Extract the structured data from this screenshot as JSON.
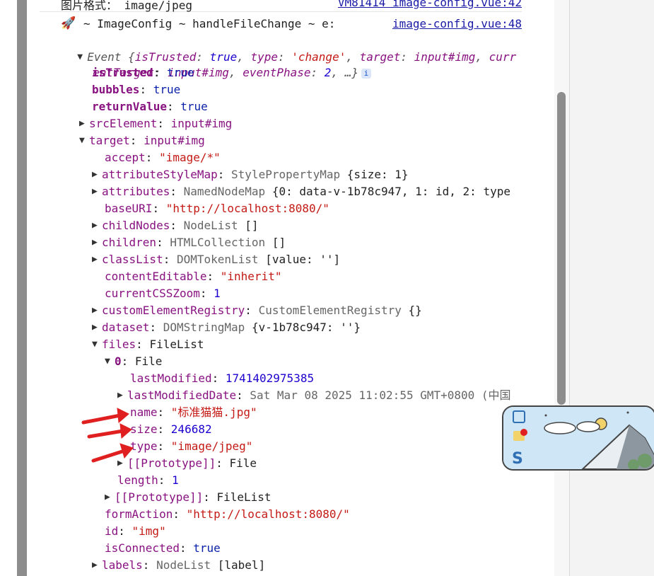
{
  "prev_message": {
    "text": "图片格式： image/jpeg",
    "source": "VM81414 image-config.vue:42"
  },
  "log": {
    "icon": "rocket-icon",
    "text": "~ ImageConfig ~ handleFileChange ~ e:",
    "source": "image-config.vue:48"
  },
  "event_summary": {
    "line1_prefix": "Event {",
    "line1_key1": "isTrusted",
    "line1_val1": "true",
    "line1_key2": "type",
    "line1_val2": "'change'",
    "line1_key3": "target",
    "line1_val3": "input#img",
    "line1_tail": "curr",
    "line2_key1": "entTarget",
    "line2_val1": "input#img",
    "line2_key2": "eventPhase",
    "line2_val2": "2",
    "line2_tail": "…}",
    "info": "i"
  },
  "props": [
    {
      "k": "isTrusted",
      "v": "true"
    },
    {
      "k": "bubbles",
      "v": "true"
    },
    {
      "k": "returnValue",
      "v": "true"
    },
    {
      "k": "srcElement",
      "v": "input#img"
    },
    {
      "k": "target",
      "v": "input#img"
    },
    {
      "k": "accept",
      "v": "\"image/*\""
    },
    {
      "k": "attributeStyleMap",
      "t": "StylePropertyMap",
      "rest": "{size: 1}"
    },
    {
      "k": "attributes",
      "t": "NamedNodeMap",
      "rest": "{0: data-v-1b78c947, 1: id, 2: type"
    },
    {
      "k": "baseURI",
      "v": "\"http://localhost:8080/\""
    },
    {
      "k": "childNodes",
      "t": "NodeList",
      "rest": "[]"
    },
    {
      "k": "children",
      "t": "HTMLCollection",
      "rest": "[]"
    },
    {
      "k": "classList",
      "t": "DOMTokenList",
      "rest": "[value: '']"
    },
    {
      "k": "contentEditable",
      "v": "\"inherit\""
    },
    {
      "k": "currentCSSZoom",
      "v": "1"
    },
    {
      "k": "customElementRegistry",
      "t": "CustomElementRegistry",
      "rest": "{}"
    },
    {
      "k": "dataset",
      "t": "DOMStringMap",
      "rest": "{v-1b78c947: ''}"
    },
    {
      "k": "files",
      "t": "FileList"
    },
    {
      "k": "0",
      "t": "File"
    },
    {
      "k": "lastModified",
      "v": "1741402975385"
    },
    {
      "k": "lastModifiedDate",
      "v": "Sat Mar 08 2025 11:02:55 GMT+0800 (中国"
    },
    {
      "k": "name",
      "v": "\"标准猫猫.jpg\""
    },
    {
      "k": "size",
      "v": "246682"
    },
    {
      "k": "type",
      "v": "\"image/jpeg\""
    },
    {
      "k": "[[Prototype]]",
      "t": "File"
    },
    {
      "k": "length",
      "v": "1"
    },
    {
      "k": "[[Prototype]]",
      "t": "FileList"
    },
    {
      "k": "formAction",
      "v": "\"http://localhost:8080/\""
    },
    {
      "k": "id",
      "v": "\"img\""
    },
    {
      "k": "isConnected",
      "v": "true"
    },
    {
      "k": "labels",
      "t": "NodeList",
      "rest": "[label]"
    }
  ],
  "colors": {
    "annotation_arrow": "#e02020",
    "key": "#881280",
    "string": "#c41a16",
    "number": "#1c00cf"
  }
}
